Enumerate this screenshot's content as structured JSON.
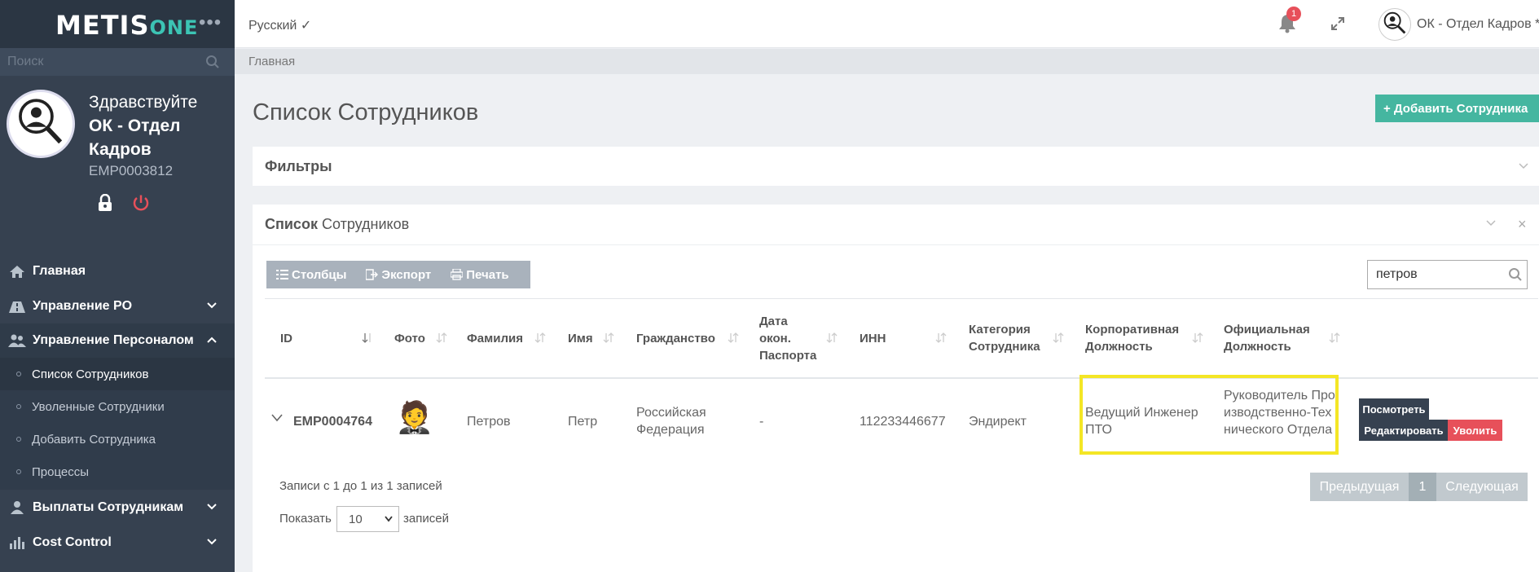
{
  "brand": {
    "logo_main": "METIS",
    "logo_suffix": "ONE",
    "menu_dots": "•••"
  },
  "sidebar": {
    "search_placeholder": "Поиск",
    "greeting": "Здравствуйте",
    "user_name": "ОК - Отдел Кадров",
    "emp_id": "EMP0003812",
    "nav": [
      {
        "label": "Главная",
        "icon": "home-icon"
      },
      {
        "label": "Управление PO",
        "icon": "road-icon",
        "expandable": true
      },
      {
        "label": "Управление Персоналом",
        "icon": "users-icon",
        "expanded": true
      },
      {
        "label": "Выплаты Сотрудникам",
        "icon": "user-money-icon",
        "expandable": true
      },
      {
        "label": "Cost Control",
        "icon": "bar-chart-icon",
        "expandable": true
      }
    ],
    "sub": [
      {
        "label": "Список Сотрудников",
        "current": true
      },
      {
        "label": "Уволенные Сотрудники"
      },
      {
        "label": "Добавить Сотрудника"
      },
      {
        "label": "Процессы"
      }
    ]
  },
  "header": {
    "language": "Русский ✓",
    "notification_count": "1",
    "user": "ОК - Отдел Кадров *"
  },
  "breadcrumb": {
    "home": "Главная"
  },
  "page": {
    "title": "Список Сотрудников",
    "add_button": "+ Добавить Сотрудника",
    "filters_title": "Фильтры",
    "list_title_bold": "Список",
    "list_title_rest": " Сотрудников",
    "close_symbol": "×"
  },
  "toolbar": {
    "columns": "Столбцы",
    "export": "Экспорт",
    "print": "Печать",
    "search_value": "петров"
  },
  "table": {
    "columns": [
      "ID",
      "Фото",
      "Фамилия",
      "Имя",
      "Гражданство",
      "Дата окон. Паспорта",
      "ИНН",
      "Категория Сотрудника",
      "Корпоративная Должность",
      "Официальная Должность"
    ],
    "rows": [
      {
        "id": "EMP0004764",
        "photo": "🤵",
        "surname": "Петров",
        "name": "Петр",
        "citizenship": "Российская Федерация",
        "passport_expiry": "-",
        "inn": "112233446677",
        "category": "Эндирект",
        "corporate_position": "Ведущий Инженер ПТО",
        "official_position": "Руководитель Производственно-Технического Отдела",
        "actions": {
          "view": "Посмотреть",
          "edit": "Редактировать",
          "fire": "Уволить"
        }
      }
    ]
  },
  "footer": {
    "info": "Записи с 1 до 1 из 1 записей",
    "show_label": "Показать",
    "page_length": "10",
    "records_label": "записей",
    "pager": {
      "prev": "Предыдущая",
      "current": "1",
      "next": "Следующая"
    }
  },
  "colors": {
    "sidebar": "#364150",
    "accent": "#45b6a0",
    "danger": "#e7505a",
    "highlight": "#f4e625"
  }
}
